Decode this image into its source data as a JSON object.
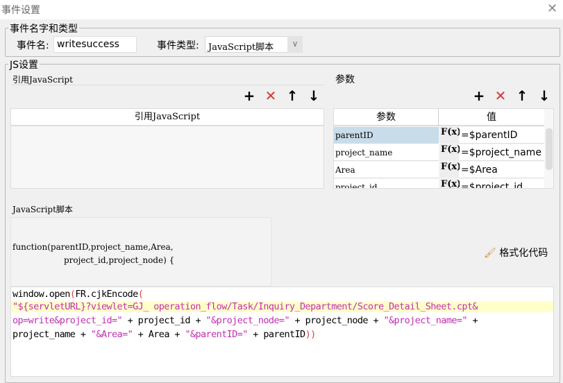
{
  "window": {
    "title": "事件设置",
    "close_icon": "close-icon"
  },
  "event": {
    "legend": "事件名字和类型",
    "name_label": "事件名:",
    "name_value": "writesuccess",
    "type_label": "事件类型:",
    "type_value": "JavaScript脚本"
  },
  "js": {
    "legend": "JS设置",
    "ref": {
      "label": "引用JavaScript",
      "column": "引用JavaScript"
    },
    "params": {
      "label": "参数",
      "col_param": "参数",
      "col_value": "值",
      "fx_label": "F(x)",
      "rows": [
        {
          "name": "parentID",
          "value": "=$parentID"
        },
        {
          "name": "project_name",
          "value": "=$project_name"
        },
        {
          "name": "Area",
          "value": "=$Area"
        },
        {
          "name": "project_id",
          "value": "=$project_id"
        }
      ]
    },
    "toolbar": {
      "add": "+",
      "delete": "✕",
      "up": "↑",
      "down": "↓"
    },
    "script_label": "JavaScript脚本",
    "signature_line1": "function(parentID,project_name,Area,",
    "signature_line2": "project_id,project_node) {",
    "format_button": "格式化代码",
    "code": {
      "l1a": "window.open",
      "l1b": "(",
      "l1c": "FR.cjkEncode",
      "l1d": "(",
      "l2": "\"${servletURL}?viewlet=GJ_ operation_flow/Task/Inquiry_Department/Score_Detail_Sheet.cpt&",
      "l3a": "op=write&project_id=\"",
      "l3b": " + project_id + ",
      "l3c": "\"&project_node=\"",
      "l3d": " + project_node + ",
      "l3e": "\"&project_name=\"",
      "l3f": " +",
      "l4a": "project_name + ",
      "l4b": "\"&Area=\"",
      "l4c": " + Area + ",
      "l4d": "\"&parentID=\"",
      "l4e": " + parentID",
      "l4f": "))"
    }
  },
  "colors": {
    "selected_row": "#c8dcea",
    "highlight_line": "#ffffc8",
    "delete": "#e03030"
  }
}
